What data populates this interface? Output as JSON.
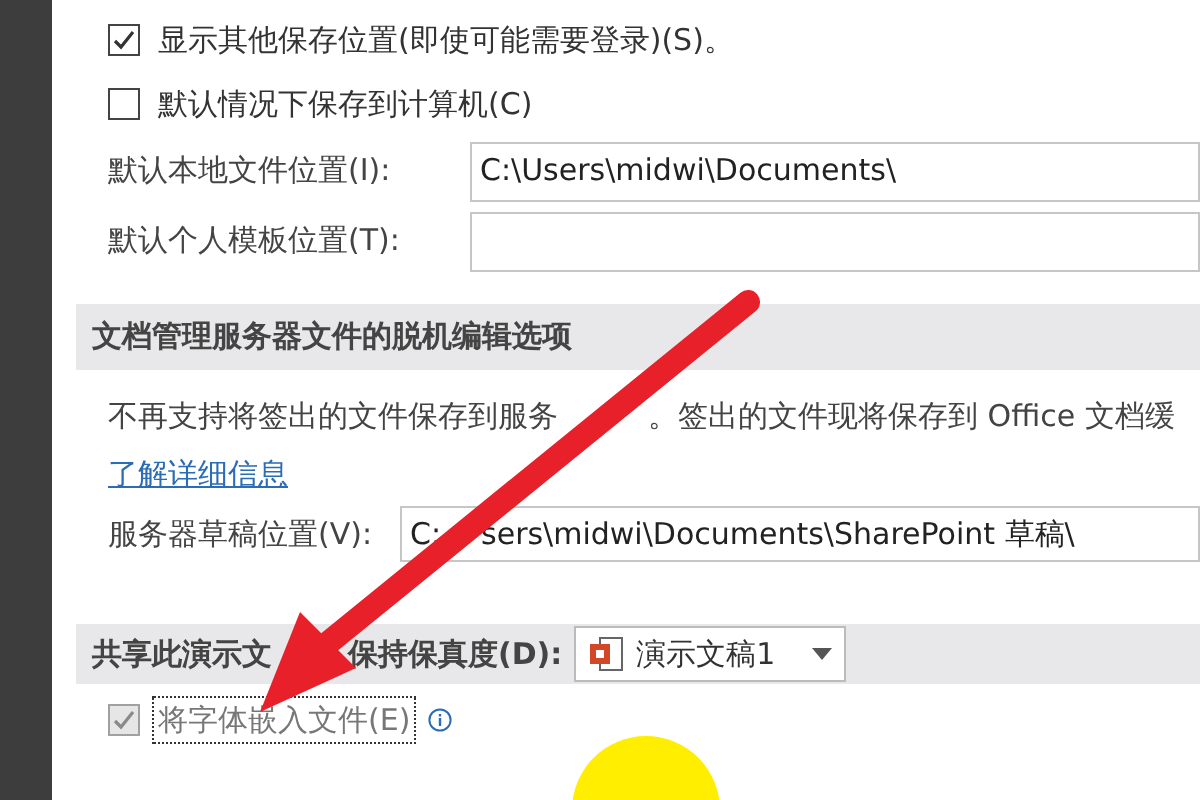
{
  "save_options": [
    {
      "label": "显示其他保存位置(即使可能需要登录)(S)。",
      "checked": true
    },
    {
      "label": "默认情况下保存到计算机(C)",
      "checked": false
    }
  ],
  "location_fields": [
    {
      "label": "默认本地文件位置(I):",
      "value": "C:\\Users\\midwi\\Documents\\"
    },
    {
      "label": "默认个人模板位置(T):"
    }
  ],
  "offline_section": {
    "title": "文档管理服务器文件的脱机编辑选项",
    "notice": [
      "不再支持将签出的文件保存到服务",
      "。签出的文件现将保存到 Office 文档缓"
    ],
    "link": "了解详细信息",
    "field_label": "服务器草稿位置(V):",
    "field_value": [
      "C:",
      "sers\\midwi\\Documents\\SharePoint 草稿\\"
    ]
  },
  "fidelity_section": {
    "title": [
      "共享此演示文",
      "保持保真度(D):"
    ],
    "document": "演示文稿1"
  },
  "fidelity_options": [
    {
      "label": "将字体嵌入文件(E)",
      "checked": true,
      "disabled": true,
      "focused": true
    }
  ]
}
